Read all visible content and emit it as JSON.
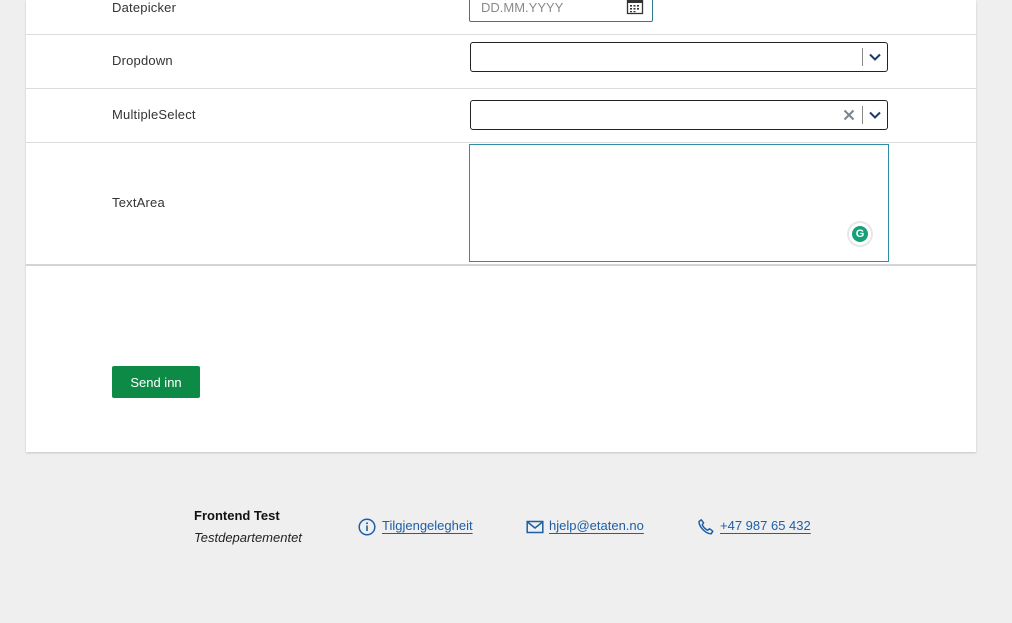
{
  "form": {
    "datepicker": {
      "label": "Datepicker",
      "placeholder": "DD.MM.YYYY"
    },
    "dropdown": {
      "label": "Dropdown",
      "value": ""
    },
    "multiselect": {
      "label": "MultipleSelect",
      "value": ""
    },
    "textarea": {
      "label": "TextArea",
      "value": ""
    },
    "submit_label": "Send inn"
  },
  "icons": {
    "datepicker": "calendar-icon",
    "select_toggle": "chevron-down-icon",
    "clear": "close-icon",
    "grammarly": "grammarly-icon",
    "accessibility": "info-icon",
    "email": "mail-icon",
    "phone": "phone-icon"
  },
  "footer": {
    "org_name": "Frontend Test",
    "department": "Testdepartementet",
    "accessibility_link": "Tilgjengelegheit",
    "email": "hjelp@etaten.no",
    "phone": "+47 987 65 432"
  },
  "colors": {
    "submit_button": "#0e8a47",
    "link": "#1d5fa6",
    "focus_border": "#2f8ea5",
    "page_background": "#efefef"
  }
}
